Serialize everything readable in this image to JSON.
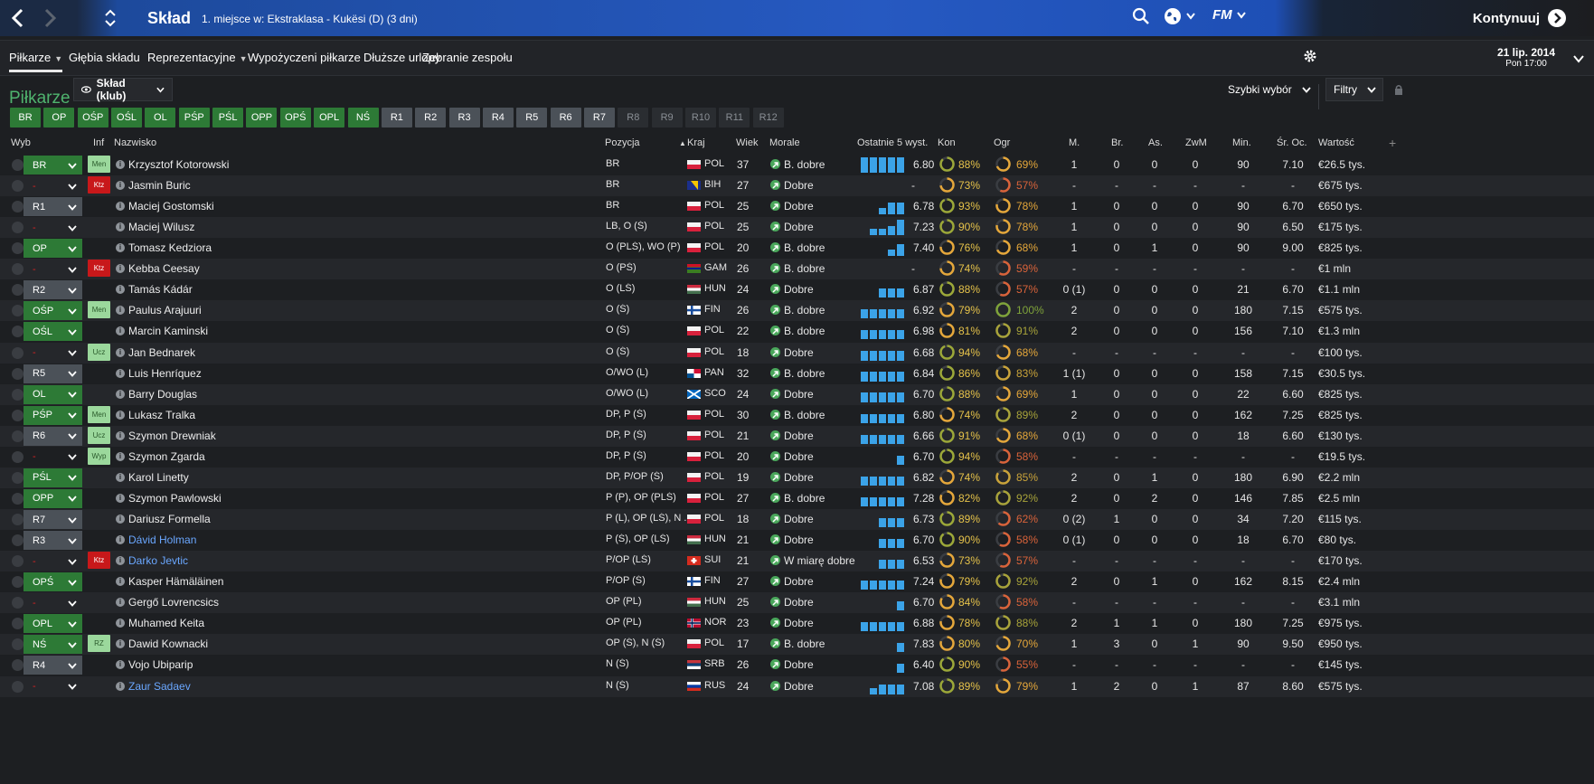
{
  "header": {
    "title": "Skład",
    "subtitle": "1. miejsce w: Ekstraklasa - Kukësi (D) (3 dni)",
    "continue": "Kontynuuj",
    "fm": "FM"
  },
  "tabs": [
    {
      "label": "Piłkarze",
      "caret": true
    },
    {
      "label": "Głębia składu",
      "caret": false
    },
    {
      "label": "Reprezentacyjne",
      "caret": true
    },
    {
      "label": "Wypożyczeni piłkarze",
      "caret": false
    },
    {
      "label": "Dłuższe urlopy",
      "caret": false
    },
    {
      "label": "Zebranie zespołu",
      "caret": false
    }
  ],
  "date": {
    "line1": "21 lip. 2014",
    "line2": "Pon 17:00"
  },
  "section": {
    "title": "Piłkarze",
    "view": "Skład (klub)",
    "quick_pick": "Szybki wybór",
    "filters": "Filtry"
  },
  "quick_buttons": [
    {
      "label": "BR",
      "state": "g"
    },
    {
      "label": "OP",
      "state": "g"
    },
    {
      "label": "OŚP",
      "state": "g"
    },
    {
      "label": "OŚL",
      "state": "g"
    },
    {
      "label": "OL",
      "state": "g"
    },
    {
      "label": "PŚP",
      "state": "g"
    },
    {
      "label": "PŚL",
      "state": "g"
    },
    {
      "label": "OPP",
      "state": "g"
    },
    {
      "label": "OPŚ",
      "state": "g"
    },
    {
      "label": "OPL",
      "state": "g"
    },
    {
      "label": "NŚ",
      "state": "g"
    },
    {
      "label": "R1",
      "state": "s"
    },
    {
      "label": "R2",
      "state": "s"
    },
    {
      "label": "R3",
      "state": "s"
    },
    {
      "label": "R4",
      "state": "s"
    },
    {
      "label": "R5",
      "state": "s"
    },
    {
      "label": "R6",
      "state": "s"
    },
    {
      "label": "R7",
      "state": "s"
    },
    {
      "label": "R8",
      "state": "d"
    },
    {
      "label": "R9",
      "state": "d"
    },
    {
      "label": "R10",
      "state": "d"
    },
    {
      "label": "R11",
      "state": "d"
    },
    {
      "label": "R12",
      "state": "d"
    }
  ],
  "columns": {
    "wyb": "Wyb",
    "inf": "Inf",
    "name": "Nazwisko",
    "pos": "Pozycja",
    "country": "Kraj",
    "age": "Wiek",
    "morale": "Morale",
    "last5": "Ostatnie 5 wyst.",
    "kon": "Kon",
    "ogr": "Ogr",
    "m": "M.",
    "br": "Br.",
    "as": "As.",
    "zwm": "ZwM",
    "min": "Min.",
    "avg": "Śr. Oc.",
    "value": "Wartość",
    "plus": "+"
  },
  "players": [
    {
      "sel": "BR",
      "st": "g",
      "inf": "Men",
      "name": "Krzysztof Kotorowski",
      "pos": "BR",
      "flag": "pol",
      "cty": "POL",
      "age": "37",
      "morale": "B. dobre",
      "bars": [
        5,
        5,
        5,
        5,
        5
      ],
      "avg": "6.80",
      "kon": "88%",
      "kp": 88,
      "ogr": "69%",
      "op": 69,
      "oc": "#e5a73a",
      "m": "1",
      "br": "0",
      "as": "0",
      "zwm": "0",
      "min": "90",
      "sr": "7.10",
      "val": "€26.5 tys."
    },
    {
      "sel": "-",
      "st": "n",
      "inf": "Ktz",
      "name": "Jasmin Buric",
      "pos": "BR",
      "flag": "bih",
      "cty": "BIH",
      "age": "27",
      "morale": "Dobre",
      "bars": [],
      "avg": "-",
      "kon": "73%",
      "kp": 73,
      "ogr": "57%",
      "op": 57,
      "oc": "#d9633a",
      "m": "-",
      "br": "-",
      "as": "-",
      "zwm": "-",
      "min": "-",
      "sr": "-",
      "val": "€675 tys."
    },
    {
      "sel": "R1",
      "st": "s",
      "inf": "",
      "name": "Maciej Gostomski",
      "pos": "BR",
      "flag": "pol",
      "cty": "POL",
      "age": "25",
      "morale": "Dobre",
      "bars": [
        0,
        0,
        2,
        4,
        4
      ],
      "avg": "6.78",
      "kon": "93%",
      "kp": 93,
      "ogr": "78%",
      "op": 78,
      "oc": "#e5a73a",
      "m": "1",
      "br": "0",
      "as": "0",
      "zwm": "0",
      "min": "90",
      "sr": "6.70",
      "val": "€650 tys."
    },
    {
      "sel": "-",
      "st": "n",
      "inf": "",
      "name": "Maciej Wilusz",
      "pos": "LB, O (Ś)",
      "flag": "pol",
      "cty": "POL",
      "age": "25",
      "morale": "Dobre",
      "bars": [
        0,
        2,
        2,
        3,
        5
      ],
      "avg": "7.23",
      "kon": "90%",
      "kp": 90,
      "ogr": "78%",
      "op": 78,
      "oc": "#e5a73a",
      "m": "1",
      "br": "0",
      "as": "0",
      "zwm": "0",
      "min": "90",
      "sr": "6.50",
      "val": "€175 tys."
    },
    {
      "sel": "OP",
      "st": "g",
      "inf": "",
      "name": "Tomasz Kedziora",
      "pos": "O (PLŚ), WO (P)",
      "flag": "pol",
      "cty": "POL",
      "age": "20",
      "morale": "B. dobre",
      "bars": [
        0,
        0,
        0,
        2,
        4
      ],
      "avg": "7.40",
      "kon": "76%",
      "kp": 76,
      "ogr": "68%",
      "op": 68,
      "oc": "#e5a73a",
      "m": "1",
      "br": "0",
      "as": "1",
      "zwm": "0",
      "min": "90",
      "sr": "9.00",
      "val": "€825 tys."
    },
    {
      "sel": "-",
      "st": "n",
      "inf": "Ktz",
      "name": "Kebba Ceesay",
      "pos": "O (PŚ)",
      "flag": "gam",
      "cty": "GAM",
      "age": "26",
      "morale": "B. dobre",
      "bars": [],
      "avg": "-",
      "kon": "74%",
      "kp": 74,
      "ogr": "59%",
      "op": 59,
      "oc": "#d9633a",
      "m": "-",
      "br": "-",
      "as": "-",
      "zwm": "-",
      "min": "-",
      "sr": "-",
      "val": "€1 mln"
    },
    {
      "sel": "R2",
      "st": "s",
      "inf": "",
      "name": "Tamás Kádár",
      "pos": "O (LŚ)",
      "flag": "hun",
      "cty": "HUN",
      "age": "24",
      "morale": "Dobre",
      "bars": [
        0,
        0,
        3,
        3,
        3
      ],
      "avg": "6.87",
      "kon": "88%",
      "kp": 88,
      "ogr": "57%",
      "op": 57,
      "oc": "#d9633a",
      "m": "0 (1)",
      "br": "0",
      "as": "0",
      "zwm": "0",
      "min": "21",
      "sr": "6.70",
      "val": "€1.1 mln"
    },
    {
      "sel": "OŚP",
      "st": "g",
      "inf": "Men",
      "name": "Paulus Arajuuri",
      "pos": "O (Ś)",
      "flag": "fin",
      "cty": "FIN",
      "age": "26",
      "morale": "B. dobre",
      "bars": [
        3,
        3,
        3,
        3,
        3
      ],
      "avg": "6.92",
      "kon": "79%",
      "kp": 79,
      "ogr": "100%",
      "op": 100,
      "oc": "#7fa33a",
      "m": "2",
      "br": "0",
      "as": "0",
      "zwm": "0",
      "min": "180",
      "sr": "7.15",
      "val": "€575 tys."
    },
    {
      "sel": "OŚL",
      "st": "g",
      "inf": "",
      "name": "Marcin Kaminski",
      "pos": "O (Ś)",
      "flag": "pol",
      "cty": "POL",
      "age": "22",
      "morale": "B. dobre",
      "bars": [
        3,
        3,
        3,
        3,
        3
      ],
      "avg": "6.98",
      "kon": "81%",
      "kp": 81,
      "ogr": "91%",
      "op": 91,
      "oc": "#a8a33a",
      "m": "2",
      "br": "0",
      "as": "0",
      "zwm": "0",
      "min": "156",
      "sr": "7.10",
      "val": "€1.3 mln"
    },
    {
      "sel": "-",
      "st": "n",
      "inf": "Ucz",
      "name": "Jan Bednarek",
      "pos": "O (Ś)",
      "flag": "pol",
      "cty": "POL",
      "age": "18",
      "morale": "Dobre",
      "bars": [
        3,
        3,
        3,
        3,
        3
      ],
      "avg": "6.68",
      "kon": "94%",
      "kp": 94,
      "ogr": "68%",
      "op": 68,
      "oc": "#e5a73a",
      "m": "-",
      "br": "-",
      "as": "-",
      "zwm": "-",
      "min": "-",
      "sr": "-",
      "val": "€100 tys."
    },
    {
      "sel": "R5",
      "st": "s",
      "inf": "",
      "name": "Luis Henríquez",
      "pos": "O/WO (L)",
      "flag": "pan",
      "cty": "PAN",
      "age": "32",
      "morale": "B. dobre",
      "bars": [
        3,
        3,
        3,
        3,
        3
      ],
      "avg": "6.84",
      "kon": "86%",
      "kp": 86,
      "ogr": "83%",
      "op": 83,
      "oc": "#c9a33a",
      "m": "1 (1)",
      "br": "0",
      "as": "0",
      "zwm": "0",
      "min": "158",
      "sr": "7.15",
      "val": "€30.5 tys."
    },
    {
      "sel": "OL",
      "st": "g",
      "inf": "",
      "name": "Barry Douglas",
      "pos": "O/WO (L)",
      "flag": "sco",
      "cty": "SCO",
      "age": "24",
      "morale": "Dobre",
      "bars": [
        3,
        3,
        3,
        3,
        3
      ],
      "avg": "6.70",
      "kon": "88%",
      "kp": 88,
      "ogr": "69%",
      "op": 69,
      "oc": "#e5a73a",
      "m": "1",
      "br": "0",
      "as": "0",
      "zwm": "0",
      "min": "22",
      "sr": "6.60",
      "val": "€825 tys."
    },
    {
      "sel": "PŚP",
      "st": "g",
      "inf": "Men",
      "name": "Lukasz Tralka",
      "pos": "DP, P (Ś)",
      "flag": "pol",
      "cty": "POL",
      "age": "30",
      "morale": "B. dobre",
      "bars": [
        3,
        3,
        3,
        3,
        3
      ],
      "avg": "6.80",
      "kon": "74%",
      "kp": 74,
      "ogr": "89%",
      "op": 89,
      "oc": "#a8a33a",
      "m": "2",
      "br": "0",
      "as": "0",
      "zwm": "0",
      "min": "162",
      "sr": "7.25",
      "val": "€825 tys."
    },
    {
      "sel": "R6",
      "st": "s",
      "inf": "Ucz",
      "name": "Szymon Drewniak",
      "pos": "DP, P (Ś)",
      "flag": "pol",
      "cty": "POL",
      "age": "21",
      "morale": "Dobre",
      "bars": [
        3,
        3,
        3,
        3,
        3
      ],
      "avg": "6.66",
      "kon": "91%",
      "kp": 91,
      "ogr": "68%",
      "op": 68,
      "oc": "#e5a73a",
      "m": "0 (1)",
      "br": "0",
      "as": "0",
      "zwm": "0",
      "min": "18",
      "sr": "6.60",
      "val": "€130 tys."
    },
    {
      "sel": "-",
      "st": "n",
      "inf": "Wyp",
      "name": "Szymon Zgarda",
      "pos": "DP, P (Ś)",
      "flag": "pol",
      "cty": "POL",
      "age": "20",
      "morale": "Dobre",
      "bars": [
        0,
        0,
        0,
        0,
        3
      ],
      "avg": "6.70",
      "kon": "94%",
      "kp": 94,
      "ogr": "58%",
      "op": 58,
      "oc": "#d9633a",
      "m": "-",
      "br": "-",
      "as": "-",
      "zwm": "-",
      "min": "-",
      "sr": "-",
      "val": "€19.5 tys."
    },
    {
      "sel": "PŚL",
      "st": "g",
      "inf": "",
      "name": "Karol Linetty",
      "pos": "DP, P/OP (Ś)",
      "flag": "pol",
      "cty": "POL",
      "age": "19",
      "morale": "Dobre",
      "bars": [
        3,
        3,
        3,
        3,
        3
      ],
      "avg": "6.82",
      "kon": "74%",
      "kp": 74,
      "ogr": "85%",
      "op": 85,
      "oc": "#c9a33a",
      "m": "2",
      "br": "0",
      "as": "1",
      "zwm": "0",
      "min": "180",
      "sr": "6.90",
      "val": "€2.2 mln"
    },
    {
      "sel": "OPP",
      "st": "g",
      "inf": "",
      "name": "Szymon Pawlowski",
      "pos": "P (P), OP (PLŚ)",
      "flag": "pol",
      "cty": "POL",
      "age": "27",
      "morale": "B. dobre",
      "bars": [
        3,
        3,
        3,
        3,
        3
      ],
      "avg": "7.28",
      "kon": "82%",
      "kp": 82,
      "ogr": "92%",
      "op": 92,
      "oc": "#a8a33a",
      "m": "2",
      "br": "0",
      "as": "2",
      "zwm": "0",
      "min": "146",
      "sr": "7.85",
      "val": "€2.5 mln"
    },
    {
      "sel": "R7",
      "st": "s",
      "inf": "",
      "name": "Dariusz Formella",
      "pos": "P (L), OP (LŚ), N ...",
      "flag": "pol",
      "cty": "POL",
      "age": "18",
      "morale": "Dobre",
      "bars": [
        0,
        0,
        3,
        3,
        3
      ],
      "avg": "6.73",
      "kon": "89%",
      "kp": 89,
      "ogr": "62%",
      "op": 62,
      "oc": "#d9633a",
      "m": "0 (2)",
      "br": "1",
      "as": "0",
      "zwm": "0",
      "min": "34",
      "sr": "7.20",
      "val": "€115 tys."
    },
    {
      "sel": "R3",
      "st": "s",
      "inf": "",
      "name": "Dávid Holman",
      "blue": true,
      "pos": "P (Ś), OP (LŚ)",
      "flag": "hun",
      "cty": "HUN",
      "age": "21",
      "morale": "Dobre",
      "bars": [
        0,
        0,
        3,
        3,
        3
      ],
      "avg": "6.70",
      "kon": "90%",
      "kp": 90,
      "ogr": "58%",
      "op": 58,
      "oc": "#d9633a",
      "m": "0 (1)",
      "br": "0",
      "as": "0",
      "zwm": "0",
      "min": "18",
      "sr": "6.70",
      "val": "€80 tys."
    },
    {
      "sel": "-",
      "st": "n",
      "inf": "Ktz",
      "name": "Darko Jevtic",
      "blue": true,
      "pos": "P/OP (LŚ)",
      "flag": "sui",
      "cty": "SUI",
      "age": "21",
      "morale": "W miarę dobre",
      "bars": [
        0,
        0,
        3,
        3,
        3
      ],
      "avg": "6.53",
      "kon": "73%",
      "kp": 73,
      "ogr": "57%",
      "op": 57,
      "oc": "#d9633a",
      "m": "-",
      "br": "-",
      "as": "-",
      "zwm": "-",
      "min": "-",
      "sr": "-",
      "val": "€170 tys."
    },
    {
      "sel": "OPŚ",
      "st": "g",
      "inf": "",
      "name": "Kasper Hämäläinen",
      "pos": "P/OP (Ś)",
      "flag": "fin",
      "cty": "FIN",
      "age": "27",
      "morale": "Dobre",
      "bars": [
        3,
        3,
        3,
        3,
        3
      ],
      "avg": "7.24",
      "kon": "79%",
      "kp": 79,
      "ogr": "92%",
      "op": 92,
      "oc": "#a8a33a",
      "m": "2",
      "br": "0",
      "as": "1",
      "zwm": "0",
      "min": "162",
      "sr": "8.15",
      "val": "€2.4 mln"
    },
    {
      "sel": "-",
      "st": "n",
      "inf": "",
      "name": "Gergő Lovrencsics",
      "pos": "OP (PL)",
      "flag": "hun",
      "cty": "HUN",
      "age": "25",
      "morale": "Dobre",
      "bars": [
        0,
        0,
        0,
        0,
        3
      ],
      "avg": "6.70",
      "kon": "84%",
      "kp": 84,
      "ogr": "58%",
      "op": 58,
      "oc": "#d9633a",
      "m": "-",
      "br": "-",
      "as": "-",
      "zwm": "-",
      "min": "-",
      "sr": "-",
      "val": "€3.1 mln"
    },
    {
      "sel": "OPL",
      "st": "g",
      "inf": "",
      "name": "Muhamed Keita",
      "pos": "OP (PL)",
      "flag": "nor",
      "cty": "NOR",
      "age": "23",
      "morale": "Dobre",
      "bars": [
        3,
        3,
        3,
        3,
        3
      ],
      "avg": "6.88",
      "kon": "78%",
      "kp": 78,
      "ogr": "88%",
      "op": 88,
      "oc": "#a8a33a",
      "m": "2",
      "br": "1",
      "as": "1",
      "zwm": "0",
      "min": "180",
      "sr": "7.25",
      "val": "€975 tys."
    },
    {
      "sel": "NŚ",
      "st": "g",
      "inf": "RZ",
      "name": "Dawid Kownacki",
      "pos": "OP (Ś), N (Ś)",
      "flag": "pol",
      "cty": "POL",
      "age": "17",
      "morale": "B. dobre",
      "bars": [
        0,
        0,
        0,
        0,
        3
      ],
      "avg": "7.83",
      "kon": "80%",
      "kp": 80,
      "ogr": "70%",
      "op": 70,
      "oc": "#e5a73a",
      "m": "1",
      "br": "3",
      "as": "0",
      "zwm": "1",
      "min": "90",
      "sr": "9.50",
      "val": "€950 tys."
    },
    {
      "sel": "R4",
      "st": "s",
      "inf": "",
      "name": "Vojo Ubiparip",
      "pos": "N (Ś)",
      "flag": "srb",
      "cty": "SRB",
      "age": "26",
      "morale": "Dobre",
      "bars": [
        0,
        0,
        0,
        0,
        3
      ],
      "avg": "6.40",
      "kon": "90%",
      "kp": 90,
      "ogr": "55%",
      "op": 55,
      "oc": "#d9633a",
      "m": "-",
      "br": "-",
      "as": "-",
      "zwm": "-",
      "min": "-",
      "sr": "-",
      "val": "€145 tys."
    },
    {
      "sel": "-",
      "st": "n",
      "inf": "",
      "name": "Zaur Sadaev",
      "blue": true,
      "pos": "N (Ś)",
      "flag": "rus",
      "cty": "RUS",
      "age": "24",
      "morale": "Dobre",
      "bars": [
        0,
        2,
        3,
        3,
        3
      ],
      "avg": "7.08",
      "kon": "89%",
      "kp": 89,
      "ogr": "79%",
      "op": 79,
      "oc": "#e5a73a",
      "m": "1",
      "br": "2",
      "as": "0",
      "zwm": "1",
      "min": "87",
      "sr": "8.60",
      "val": "€575 tys."
    }
  ]
}
